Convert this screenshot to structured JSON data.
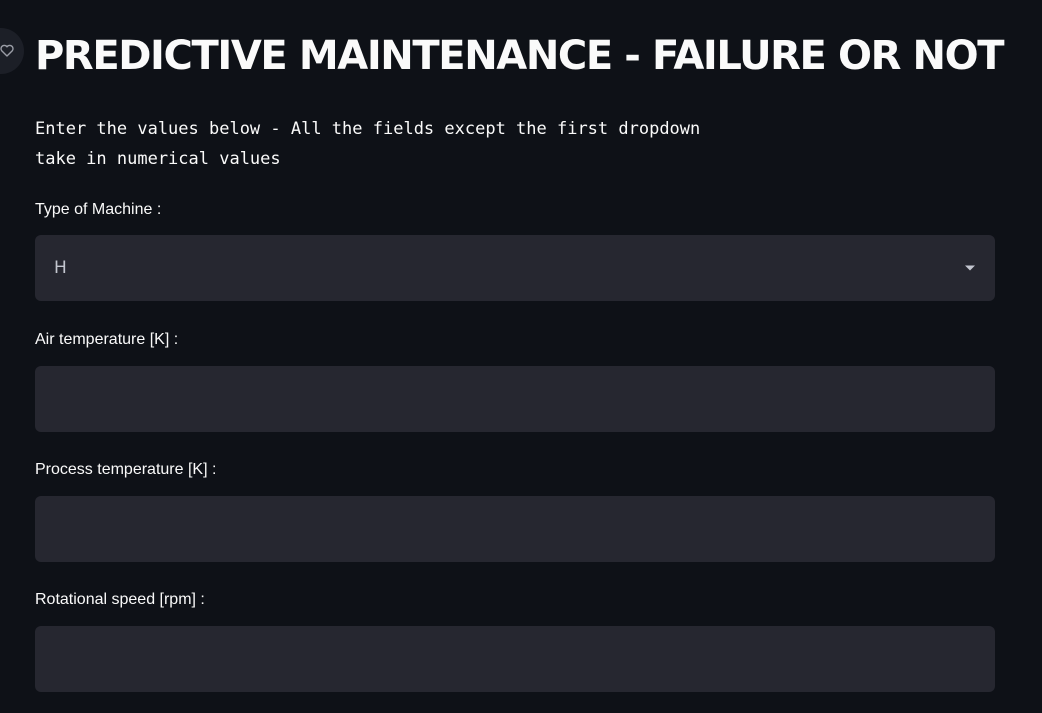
{
  "page": {
    "title": "PREDICTIVE MAINTENANCE - FAILURE OR NOT",
    "intro": "Enter the values below - All the fields except the first dropdown\ntake in numerical values"
  },
  "form": {
    "machine_type": {
      "label": "Type of Machine :",
      "selected": "H"
    },
    "air_temperature": {
      "label": "Air temperature [K] :",
      "value": ""
    },
    "process_temperature": {
      "label": "Process temperature [K] :",
      "value": ""
    },
    "rotational_speed": {
      "label": "Rotational speed [rpm] :",
      "value": ""
    }
  },
  "colors": {
    "background": "#0e1117",
    "field_background": "#262730",
    "text": "#fafafa",
    "muted_text": "#c3c6cf"
  },
  "icons": {
    "corner": "heart-icon",
    "dropdown": "caret-down-icon"
  }
}
